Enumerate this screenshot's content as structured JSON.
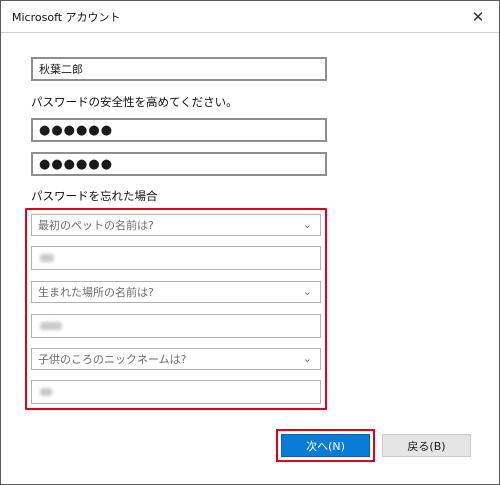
{
  "window": {
    "title": "Microsoft アカウント"
  },
  "form": {
    "name_value": "秋葉二郎",
    "password_instruction": "パスワードの安全性を高めてください。",
    "password_value": "●●●●●●",
    "password_confirm_value": "●●●●●●",
    "security_heading": "パスワードを忘れた場合",
    "questions": [
      {
        "question": "最初のペットの名前は?"
      },
      {
        "question": "生まれた場所の名前は?"
      },
      {
        "question": "子供のころのニックネームは?"
      }
    ]
  },
  "buttons": {
    "next_label": "次へ(N)",
    "back_label": "戻る(B)"
  },
  "icons": {
    "close": "close-icon",
    "dropdown": "chevron-down-icon"
  },
  "colors": {
    "accent": "#0a7bd6",
    "highlight": "#e4001b"
  }
}
